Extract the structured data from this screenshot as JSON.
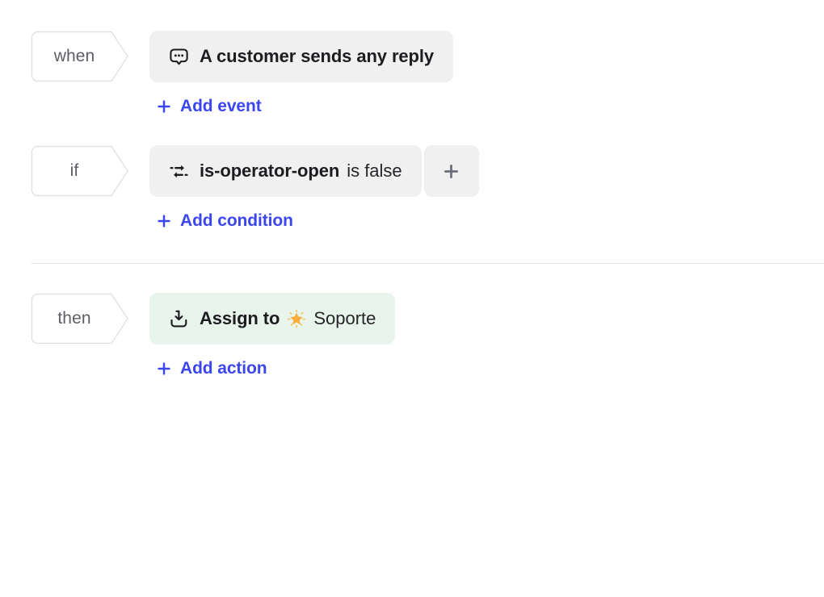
{
  "workflow": {
    "trigger": {
      "tag": "when",
      "chip": {
        "icon": "speech-bubble-dots-icon",
        "label": "A customer sends any reply"
      },
      "add_label": "Add event"
    },
    "condition": {
      "tag": "if",
      "chip": {
        "icon": "exchange-arrows-icon",
        "subject": "is-operator-open",
        "predicate": "is false"
      },
      "add_segment_label": "+",
      "add_label": "Add condition"
    },
    "action": {
      "tag": "then",
      "chip": {
        "icon": "assign-inbox-icon",
        "label": "Assign to",
        "emoji": "🌟",
        "assignee": "Soporte"
      },
      "add_label": "Add action"
    },
    "plus_glyph": "+"
  },
  "colors": {
    "accent_link": "#3b46f1",
    "chip_neutral_bg": "#f0f0f0",
    "chip_action_bg": "#e8f5ec",
    "tag_border": "#e2e2e4",
    "divider": "#e4e4e6",
    "text_primary": "#1d1d21",
    "tag_text": "#5c5f66",
    "star_gold": "#f9ad3c"
  }
}
